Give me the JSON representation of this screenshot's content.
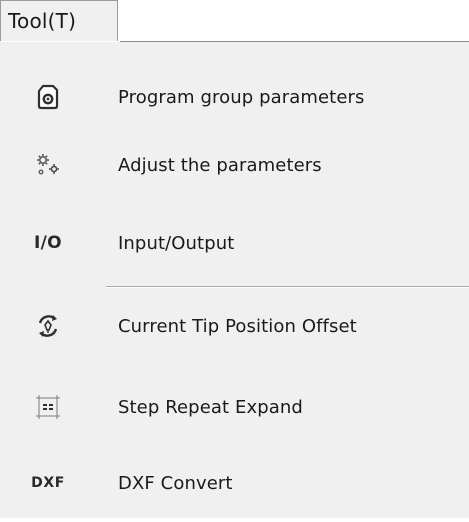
{
  "menubar": {
    "tab_label": "Tool(T)"
  },
  "menu": {
    "items": [
      {
        "label": "Program group parameters",
        "icon": "document-gear-icon"
      },
      {
        "label": "Adjust the parameters",
        "icon": "gears-icon"
      },
      {
        "label": "Input/Output",
        "icon": "io-icon",
        "icon_text": "I/O"
      },
      {
        "label": "Current Tip Position Offset",
        "icon": "tip-offset-icon"
      },
      {
        "label": "Step Repeat Expand",
        "icon": "step-repeat-icon"
      },
      {
        "label": "DXF Convert",
        "icon": "dxf-icon",
        "icon_text": "DXF"
      }
    ]
  }
}
